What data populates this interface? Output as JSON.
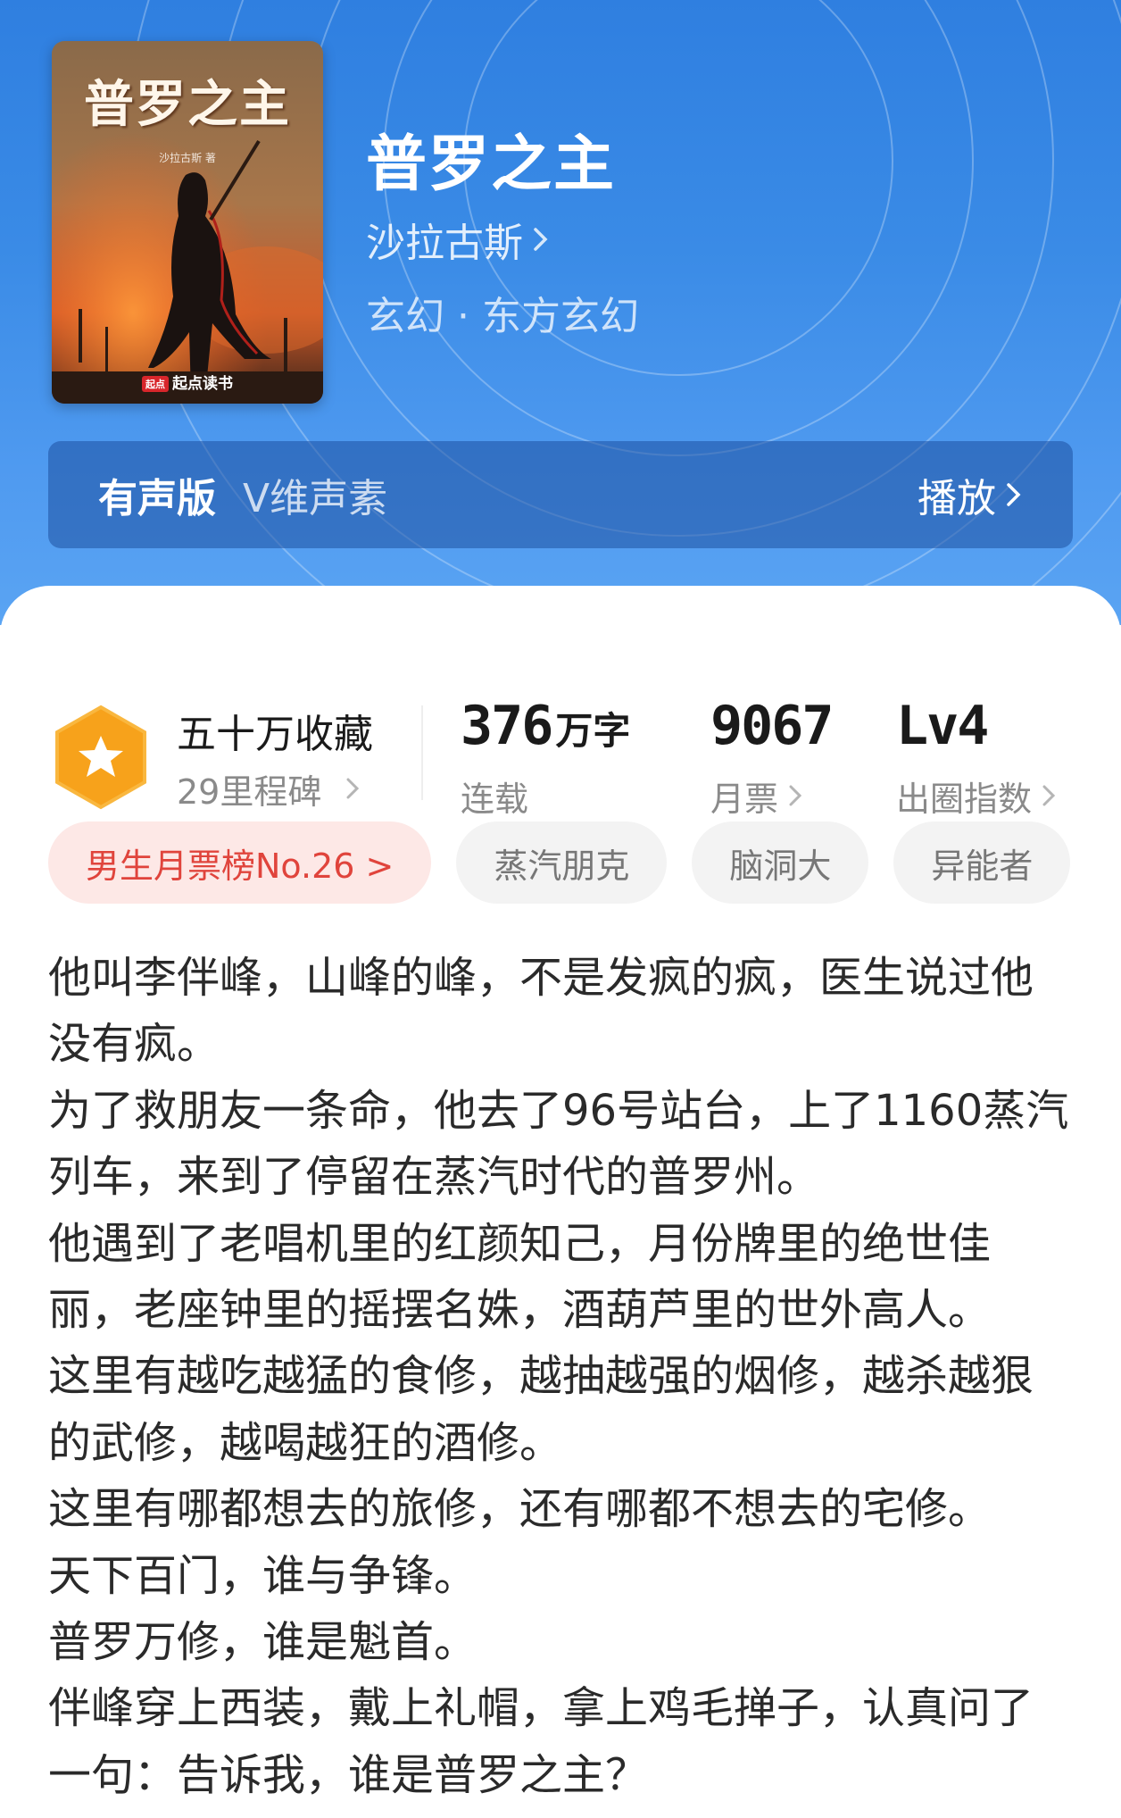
{
  "book": {
    "title": "普罗之主",
    "author": "沙拉古斯",
    "genre": "玄幻 · 东方玄幻",
    "cover": {
      "title": "普罗之主",
      "author_credit": "沙拉古斯 著",
      "publisher": "起点读书",
      "publisher_logo": "起点"
    }
  },
  "audio": {
    "label": "有声版",
    "voice": "V维声素",
    "play_label": "播放"
  },
  "stats": {
    "favorites": {
      "main": "五十万收藏",
      "sub": "29里程碑"
    },
    "words": {
      "value": "376",
      "unit": "万字",
      "label": "连载"
    },
    "monthly_votes": {
      "value": "9067",
      "label": "月票"
    },
    "influence": {
      "value": "Lv4",
      "label": "出圈指数"
    }
  },
  "tags": [
    {
      "label": "男生月票榜No.26 >"
    },
    {
      "label": "蒸汽朋克"
    },
    {
      "label": "脑洞大"
    },
    {
      "label": "异能者"
    }
  ],
  "synopsis": [
    "他叫李伴峰，山峰的峰，不是发疯的疯，医生说过他没有疯。",
    "为了救朋友一条命，他去了96号站台，上了1160蒸汽列车，来到了停留在蒸汽时代的普罗州。",
    "他遇到了老唱机里的红颜知己，月份牌里的绝世佳丽，老座钟里的摇摆名姝，酒葫芦里的世外高人。",
    "这里有越吃越猛的食修，越抽越强的烟修，越杀越狠的武修，越喝越狂的酒修。",
    "这里有哪都想去的旅修，还有哪都不想去的宅修。",
    "天下百门，谁与争锋。",
    "普罗万修，谁是魁首。",
    "伴峰穿上西装，戴上礼帽，拿上鸡毛掸子，认真问了一句：告诉我，谁是普罗之主？"
  ],
  "colors": {
    "header_blue": "#3a8be6",
    "rank_red": "#e0443c",
    "badge_orange": "#f7a21b"
  }
}
